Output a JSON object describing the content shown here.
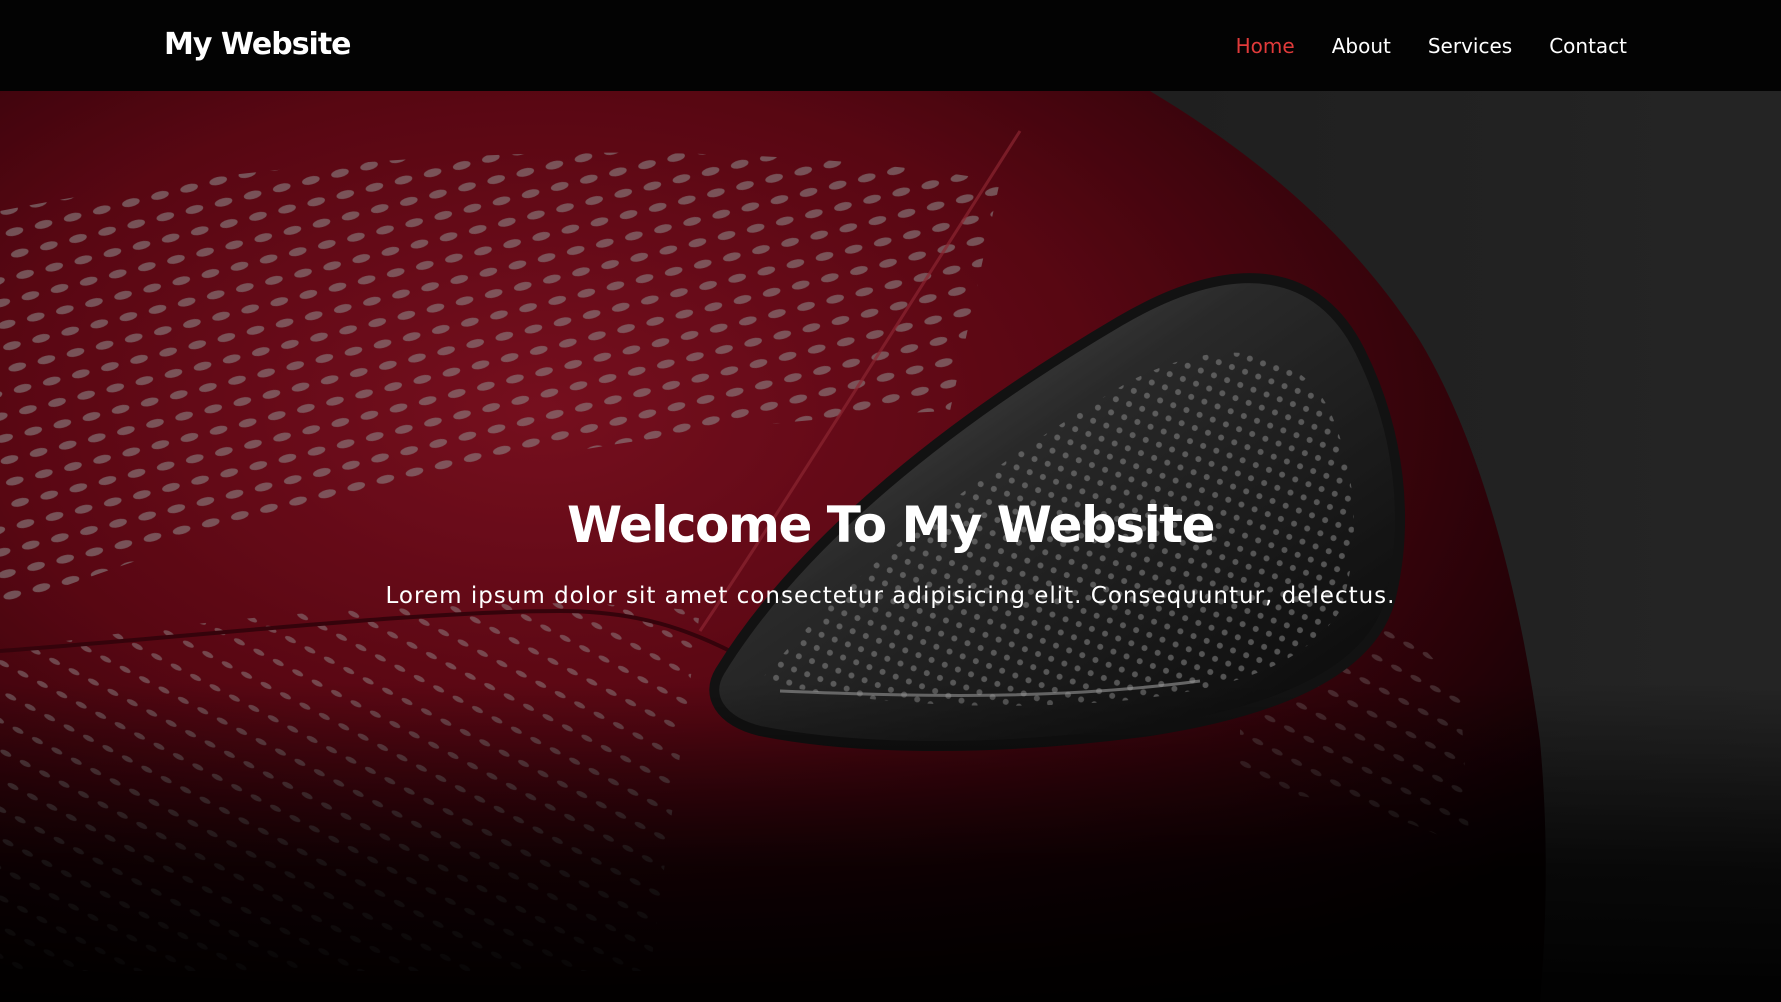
{
  "navbar": {
    "brand": "My Website",
    "links": [
      {
        "label": "Home",
        "active": true
      },
      {
        "label": "About",
        "active": false
      },
      {
        "label": "Services",
        "active": false
      },
      {
        "label": "Contact",
        "active": false
      }
    ]
  },
  "hero": {
    "title": "Welcome To My Website",
    "subtitle": "Lorem ipsum dolor sit amet consectetur adipisicing elit. Consequuntur, delectus."
  },
  "colors": {
    "navbar_background": "#030303",
    "text": "#ffffff",
    "active_link": "#e03a3a",
    "car_red": "#8a0c1c"
  }
}
